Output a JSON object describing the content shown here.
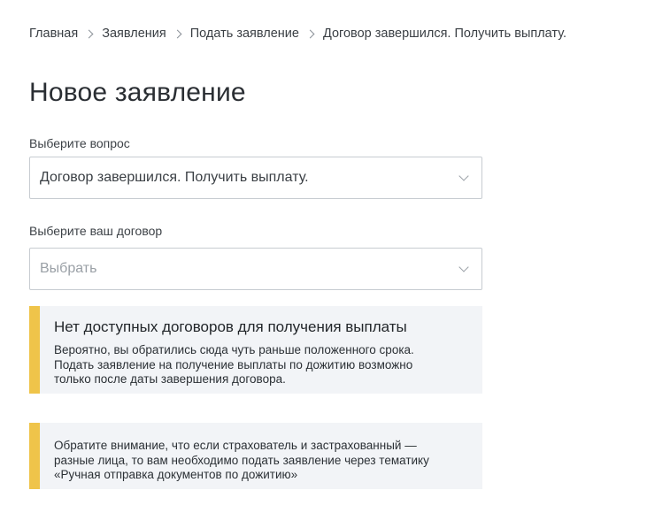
{
  "breadcrumb": {
    "items": [
      "Главная",
      "Заявления",
      "Подать заявление",
      "Договор завершился. Получить выплату."
    ]
  },
  "page": {
    "title": "Новое заявление"
  },
  "question_select": {
    "label": "Выберите вопрос",
    "value": "Договор завершился. Получить выплату."
  },
  "contract_select": {
    "label": "Выберите ваш договор",
    "placeholder": "Выбрать"
  },
  "notice_no_contracts": {
    "title": "Нет доступных договоров для получения выплаты",
    "text": "Вероятно, вы обратились сюда чуть раньше положенного срока.\nПодать заявление на получение выплаты по дожитию возможно\nтолько после даты завершения договора."
  },
  "notice_attention": {
    "text": "Обратите внимание, что если страхователь и застрахованный —\nразные лица, то вам необходимо подать заявление через тематику\n«Ручная отправка документов по дожитию»"
  },
  "colors": {
    "accent_yellow": "#efc44a",
    "notice_bg": "#f2f4f7",
    "border": "#c7ccd1"
  }
}
